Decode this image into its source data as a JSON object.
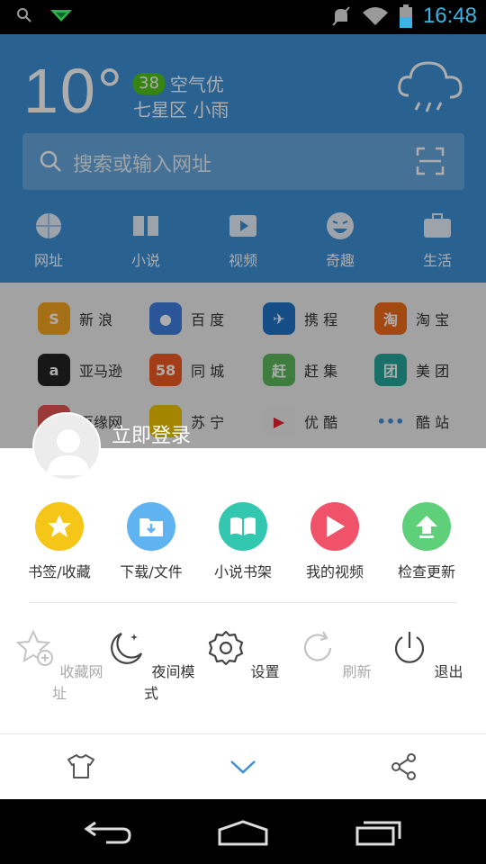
{
  "status_bar": {
    "time": "16:48"
  },
  "weather": {
    "temperature": "10°",
    "aqi_value": "38",
    "aqi_label": "空气优",
    "location": "七星区  小雨"
  },
  "search": {
    "placeholder": "搜索或输入网址"
  },
  "categories": [
    "网址",
    "小说",
    "视频",
    "奇趣",
    "生活"
  ],
  "sites": [
    {
      "name": "新 浪",
      "logo": "S",
      "color": "#f5a623"
    },
    {
      "name": "百 度",
      "logo": "●",
      "color": "#3e7fe0"
    },
    {
      "name": "携 程",
      "logo": "✈",
      "color": "#1f74c8"
    },
    {
      "name": "淘 宝",
      "logo": "淘",
      "color": "#f06a1a"
    },
    {
      "name": "亚马逊",
      "logo": "a",
      "color": "#222222"
    },
    {
      "name": "同 城",
      "logo": "58",
      "color": "#f15a24"
    },
    {
      "name": "赶 集",
      "logo": "赶",
      "color": "#5cb85c"
    },
    {
      "name": "美 团",
      "logo": "团",
      "color": "#26a69a"
    },
    {
      "name": "百缘网",
      "logo": "",
      "color": "#e55353"
    },
    {
      "name": "苏 宁",
      "logo": "",
      "color": "#f2c500"
    },
    {
      "name": "优 酷",
      "logo": "▶",
      "color": "#eeeeee"
    },
    {
      "name": "酷 站",
      "logo": "•••",
      "color": "transparent"
    }
  ],
  "user": {
    "login_label": "立即登录"
  },
  "menu_primary": [
    {
      "label": "书签/收藏",
      "color": "#f5c518",
      "icon": "star-icon"
    },
    {
      "label": "下载/文件",
      "color": "#5fb3f0",
      "icon": "download-folder-icon"
    },
    {
      "label": "小说书架",
      "color": "#33c7b0",
      "icon": "book-icon"
    },
    {
      "label": "我的视频",
      "color": "#f0526a",
      "icon": "play-icon"
    },
    {
      "label": "检查更新",
      "color": "#5fd07a",
      "icon": "upload-arrow-icon"
    }
  ],
  "menu_secondary": [
    {
      "label": "收藏网址",
      "enabled": false,
      "icon": "add-star-icon"
    },
    {
      "label": "夜间模式",
      "enabled": true,
      "icon": "moon-icon"
    },
    {
      "label": "设置",
      "enabled": true,
      "icon": "gear-icon"
    },
    {
      "label": "刷新",
      "enabled": false,
      "icon": "refresh-icon"
    },
    {
      "label": "退出",
      "enabled": true,
      "icon": "power-icon"
    }
  ],
  "footer": {
    "icons": [
      "tshirt-icon",
      "chevron-down-icon",
      "share-icon"
    ]
  }
}
